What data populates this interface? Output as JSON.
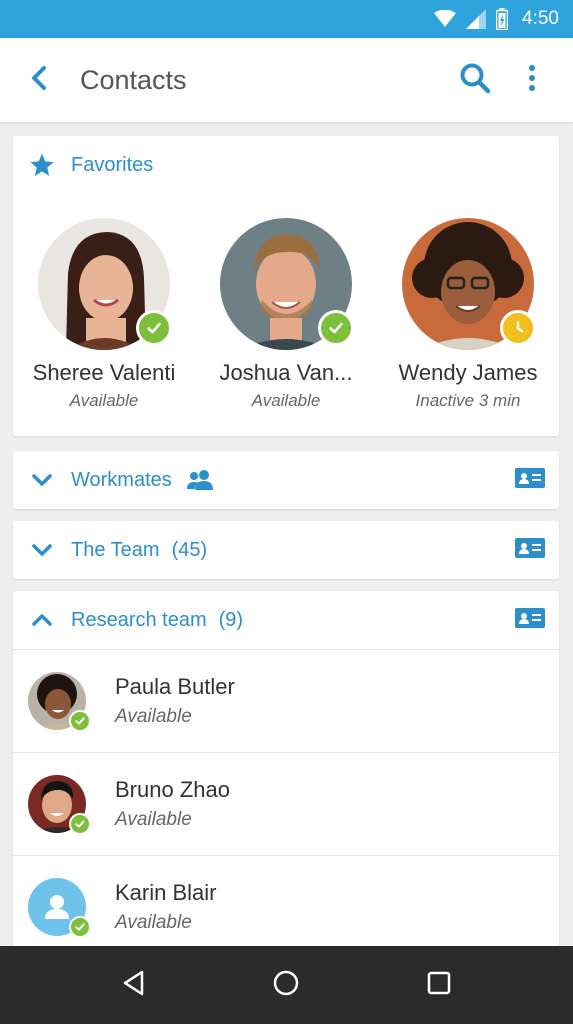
{
  "status_bar": {
    "time": "4:50",
    "icons": [
      "wifi-icon",
      "signal-icon",
      "battery-icon"
    ]
  },
  "app_bar": {
    "title": "Contacts",
    "back_icon": "back-arrow-icon",
    "search_icon": "search-icon",
    "menu_icon": "more-vert-icon"
  },
  "favorites": {
    "label": "Favorites",
    "icon": "star-icon",
    "people": [
      {
        "name": "Sheree Valenti",
        "status": "Available",
        "presence": "available"
      },
      {
        "name": "Joshua Van...",
        "status": "Available",
        "presence": "available"
      },
      {
        "name": "Wendy James",
        "status": "Inactive 3 min",
        "presence": "away"
      }
    ]
  },
  "groups": [
    {
      "label": "Workmates",
      "count": "",
      "expanded": false,
      "extra_icon": "people-icon",
      "right_icon": "contact-card-icon"
    },
    {
      "label": "The Team",
      "count": "(45)",
      "expanded": false,
      "right_icon": "contact-card-icon"
    },
    {
      "label": "Research team",
      "count": "(9)",
      "expanded": true,
      "right_icon": "contact-card-icon"
    }
  ],
  "research_members": [
    {
      "name": "Paula Butler",
      "status": "Available",
      "presence": "available"
    },
    {
      "name": "Bruno Zhao",
      "status": "Available",
      "presence": "available"
    },
    {
      "name": "Karin Blair",
      "status": "Available",
      "presence": "available"
    }
  ],
  "nav_bar": {
    "back": "nav-back-icon",
    "home": "nav-home-icon",
    "recents": "nav-recents-icon"
  },
  "colors": {
    "accent": "#2c8fc9",
    "status_bar": "#2ea3dc",
    "available": "#7bbf3a",
    "away": "#f2c01e",
    "nav": "#2b2b2b"
  }
}
